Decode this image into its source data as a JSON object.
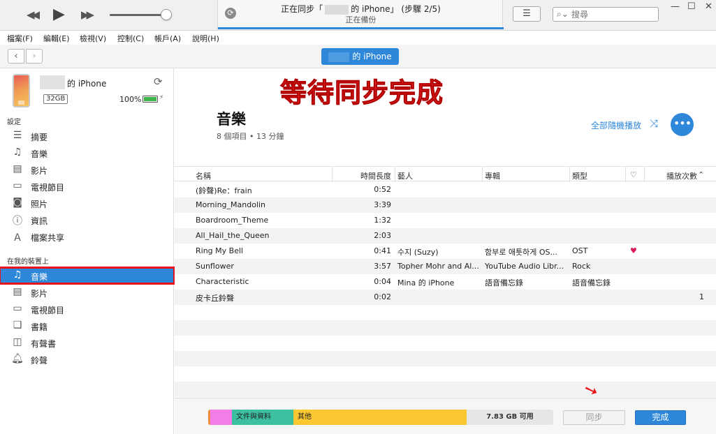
{
  "colors": {
    "accent": "#2f87da",
    "highlight": "#e8141c",
    "overlay_text": "#ee2a2a"
  },
  "titlebar": {
    "playback": {
      "rewind_icon": "rewind-icon",
      "play_icon": "play-icon",
      "forward_icon": "fast-forward-icon"
    },
    "volume_level": 0.9,
    "status_line1_prefix": "正在同步「",
    "status_line1_suffix": "的 iPhone」 (步驟 2/5)",
    "status_line2": "正在備份",
    "sync_progress": 1.0,
    "search_placeholder": "搜尋",
    "win_minimize": "—",
    "win_maximize": "☐",
    "win_close": "✕"
  },
  "menu": [
    "檔案(F)",
    "編輯(E)",
    "檢視(V)",
    "控制(C)",
    "帳戶(A)",
    "說明(H)"
  ],
  "nav": {
    "back": "‹",
    "forward": "›",
    "device_label": "的 iPhone"
  },
  "device": {
    "name": "的 iPhone",
    "capacity": "32GB",
    "battery_pct": "100%",
    "battery_level": 1.0
  },
  "sidebar": {
    "settings_header": "設定",
    "settings_items": [
      {
        "label": "摘要",
        "icon": "summary-icon"
      },
      {
        "label": "音樂",
        "icon": "music-note-icon"
      },
      {
        "label": "影片",
        "icon": "film-icon"
      },
      {
        "label": "電視節目",
        "icon": "tv-icon"
      },
      {
        "label": "照片",
        "icon": "camera-icon"
      },
      {
        "label": "資訊",
        "icon": "info-icon"
      },
      {
        "label": "檔案共享",
        "icon": "app-store-icon"
      }
    ],
    "device_header": "在我的裝置上",
    "device_items": [
      {
        "label": "音樂",
        "icon": "music-note-icon",
        "active": true
      },
      {
        "label": "影片",
        "icon": "film-icon"
      },
      {
        "label": "電視節目",
        "icon": "tv-icon"
      },
      {
        "label": "書籍",
        "icon": "book-icon"
      },
      {
        "label": "有聲書",
        "icon": "audiobook-icon"
      },
      {
        "label": "鈴聲",
        "icon": "bell-icon"
      }
    ]
  },
  "main": {
    "overlay_caption": "等待同步完成",
    "title": "音樂",
    "subtitle": "8 個項目 • 13 分鐘",
    "shuffle_label": "全部隨機播放",
    "more_label": "•••"
  },
  "table": {
    "headers": {
      "name": "名稱",
      "time": "時間長度",
      "artist": "藝人",
      "album": "專輯",
      "genre": "類型",
      "love": "♡",
      "plays": "播放次數"
    },
    "rows": [
      {
        "name": "(鈴聲)Re：frain",
        "time": "0:52",
        "artist": "",
        "album": "",
        "genre": "",
        "loved": false,
        "plays": ""
      },
      {
        "name": "Morning_Mandolin",
        "time": "3:39",
        "artist": "",
        "album": "",
        "genre": "",
        "loved": false,
        "plays": ""
      },
      {
        "name": "Boardroom_Theme",
        "time": "1:32",
        "artist": "",
        "album": "",
        "genre": "",
        "loved": false,
        "plays": ""
      },
      {
        "name": "All_Hail_the_Queen",
        "time": "2:03",
        "artist": "",
        "album": "",
        "genre": "",
        "loved": false,
        "plays": ""
      },
      {
        "name": "Ring My Bell",
        "time": "0:41",
        "artist": "수지 (Suzy)",
        "album": "함부로 애틋하게 OS...",
        "genre": "OST",
        "loved": true,
        "plays": ""
      },
      {
        "name": "Sunflower",
        "time": "3:57",
        "artist": "Topher Mohr and Al...",
        "album": "YouTube Audio Libr...",
        "genre": "Rock",
        "loved": false,
        "plays": ""
      },
      {
        "name": "Characteristic",
        "time": "0:04",
        "artist": "Mina 的 iPhone",
        "album": "語音備忘錄",
        "genre": "語音備忘錄",
        "loved": false,
        "plays": ""
      },
      {
        "name": "皮卡丘鈴聲",
        "time": "0:02",
        "artist": "",
        "album": "",
        "genre": "",
        "loved": false,
        "plays": "1"
      }
    ],
    "empty_rows": 6
  },
  "storage": {
    "segments": [
      {
        "label": "",
        "color": "#f08a3c",
        "fraction": 0.006
      },
      {
        "label": "",
        "color": "#f27ce8",
        "fraction": 0.062
      },
      {
        "label": "文件與資料",
        "color": "#3cc0a0",
        "fraction": 0.178
      },
      {
        "label": "其他",
        "color": "#fbc832",
        "fraction": 0.503
      }
    ],
    "free_label": "7.83 GB 可用"
  },
  "buttons": {
    "sync": "同步",
    "done": "完成"
  }
}
